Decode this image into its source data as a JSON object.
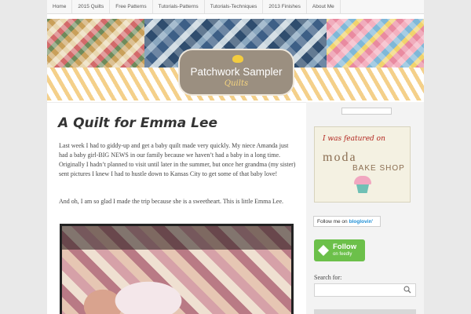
{
  "nav": {
    "items": [
      "Home",
      "2015 Quilts",
      "Free Patterns",
      "Tutorials-Patterns",
      "Tutorials-Techniques",
      "2013 Finishes",
      "About Me"
    ]
  },
  "header": {
    "logo_title": "Patchwork Sampler",
    "logo_subtitle": "Quilts"
  },
  "post": {
    "title": "A Quilt for Emma Lee",
    "paragraph1": "Last week I had to giddy-up and get a baby quilt made very quickly.  My niece Amanda  just had a baby girl-BIG NEWS in our family because we haven’t had a baby in a long time. Originally I hadn’t planned to visit until later in the summer, but once her grandma (my sister) sent pictures I knew I had to hustle down to Kansas City to get some of that baby love!",
    "paragraph2": "And oh, I am so glad I made the trip because she is a sweetheart.  This is little Emma Lee."
  },
  "sidebar": {
    "featured_text": "I was featured on",
    "featured_moda": "moda",
    "featured_bakeshop": "BAKE SHOP",
    "bloglovin_prefix": "Follow me on",
    "bloglovin_brand": "bloglovin'",
    "feedly_follow": "Follow",
    "feedly_sub": "on feedly",
    "search_label": "Search for:",
    "search_placeholder": ""
  },
  "colors": {
    "accent_yellow": "#f4d08a",
    "feedly_green": "#6cc04a",
    "bloglovin_blue": "#1f8fd6",
    "logo_plate": "#9b8f80"
  },
  "icons": [
    "bird-logo-icon",
    "feedly-icon",
    "search-icon",
    "cupcake-icon"
  ]
}
